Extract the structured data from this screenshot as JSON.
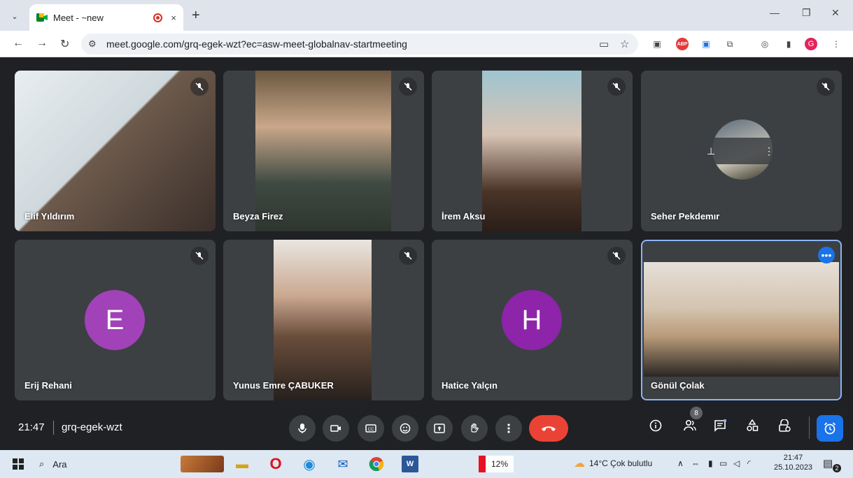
{
  "browser": {
    "tab_title": "Meet - ~new",
    "tab_close": "×",
    "new_tab": "+",
    "minimize": "—",
    "restore": "❐",
    "close": "✕",
    "url": "meet.google.com/grq-egek-wzt?ec=asw-meet-globalnav-startmeeting",
    "profile_initial": "G"
  },
  "participants": [
    {
      "name": "Elif Yıldırım",
      "muted": true,
      "mode": "video"
    },
    {
      "name": "Beyza Firez",
      "muted": true,
      "mode": "video"
    },
    {
      "name": "İrem Aksu",
      "muted": true,
      "mode": "video"
    },
    {
      "name": "Seher Pekdemır",
      "muted": true,
      "mode": "video-small"
    },
    {
      "name": "Erij Rehani",
      "muted": true,
      "mode": "avatar",
      "initial": "E",
      "color": "#a142b8"
    },
    {
      "name": "Yunus Emre ÇABUKER",
      "muted": true,
      "mode": "video"
    },
    {
      "name": "Hatice Yalçın",
      "muted": true,
      "mode": "avatar",
      "initial": "H",
      "color": "#8e24aa"
    },
    {
      "name": "Gönül Çolak",
      "muted": false,
      "mode": "video",
      "active": true
    }
  ],
  "meeting": {
    "time": "21:47",
    "code": "grq-egek-wzt",
    "participant_count": "8"
  },
  "icons": {
    "mic": "mic-icon",
    "camera": "camera-icon",
    "captions": "captions-icon",
    "emoji": "emoji-icon",
    "present": "present-icon",
    "hand": "raise-hand-icon",
    "more": "more-options-icon",
    "end": "end-call-icon",
    "info": "info-icon",
    "people": "people-icon",
    "chat": "chat-icon",
    "activities": "activities-icon",
    "host": "host-controls-icon",
    "timer": "alarm-icon"
  },
  "taskbar": {
    "search_label": "Ara",
    "battery": "12%",
    "weather": "14°C  Çok bulutlu",
    "time": "21:47",
    "date": "25.10.2023",
    "notifications": "2"
  },
  "colors": {
    "accent": "#1a73e8",
    "end_call": "#ea4335",
    "tile": "#3c4043",
    "background": "#202124"
  }
}
